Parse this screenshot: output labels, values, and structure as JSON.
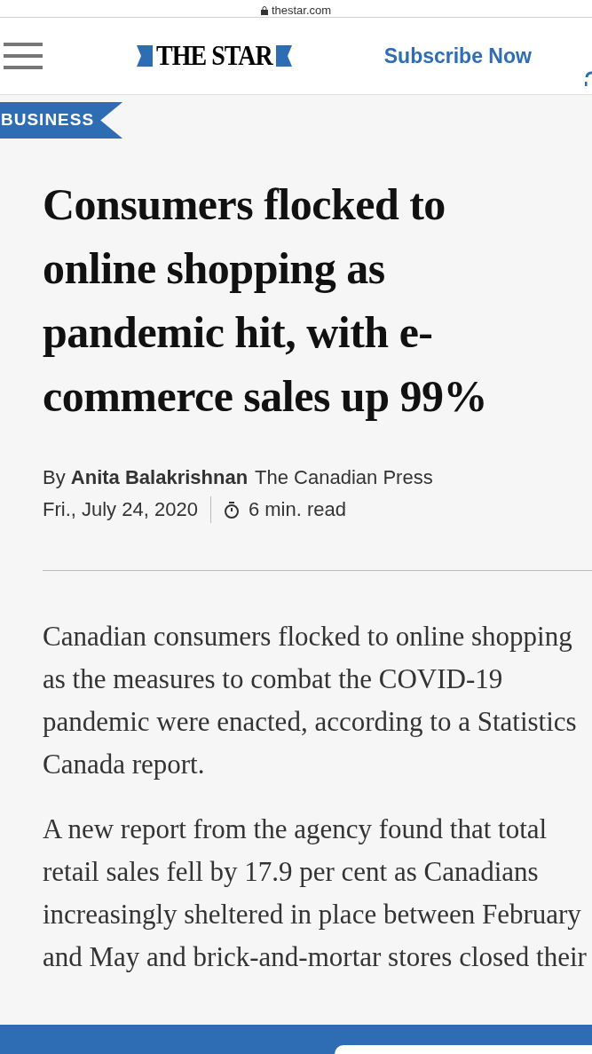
{
  "address_bar": {
    "url": "thestar.com"
  },
  "header": {
    "logo": "THE STAR",
    "subscribe": "Subscribe Now"
  },
  "section_tag": "BUSINESS",
  "headline": "Consumers flocked to online shopping as pandemic hit, with e-commerce sales up 99%",
  "byline": {
    "prefix": "By",
    "author": "Anita Balakrishnan",
    "source": "The Canadian Press",
    "date": "Fri., July 24, 2020",
    "read_time": "6 min. read"
  },
  "paragraphs": [
    "Canadian consumers flocked to online shopping as the measures to combat the COVID-19 pandemic were enacted, according to a Statistics Canada report.",
    "A new report from the agency found that total retail sales fell by 17.9 per cent as Canadians increasingly sheltered in place between February and May and brick-and-mortar stores closed their"
  ]
}
